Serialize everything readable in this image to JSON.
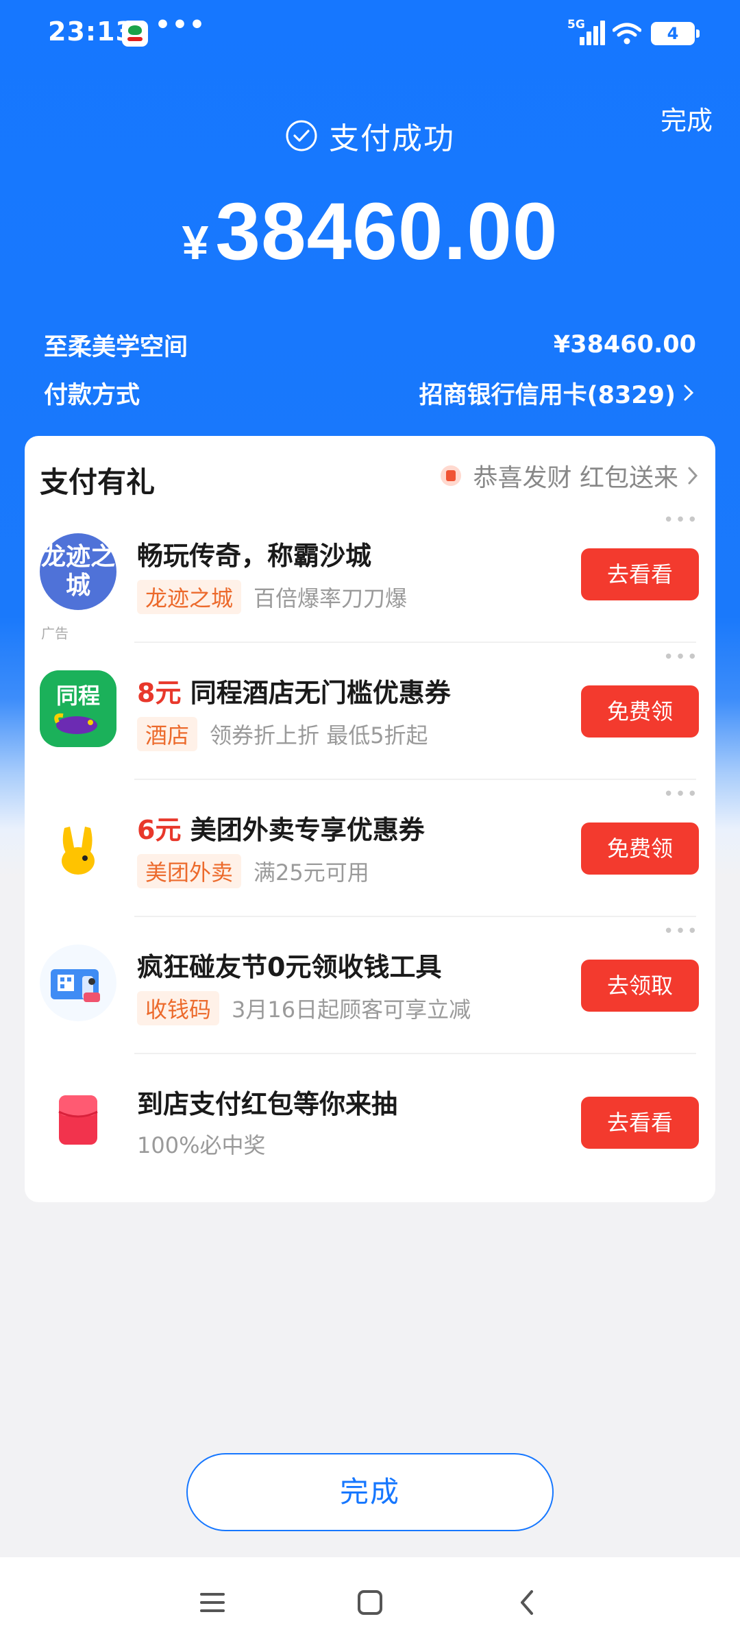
{
  "status_bar": {
    "time": "23:13",
    "more": "•••",
    "network": "5G",
    "battery": "4"
  },
  "header": {
    "done_label": "完成",
    "success_text": "支付成功",
    "currency": "¥",
    "amount": "38460.00",
    "merchant_name": "至柔美学空间",
    "merchant_amount": "¥38460.00",
    "payment_method_label": "付款方式",
    "payment_method_value": "招商银行信用卡(8329)"
  },
  "card": {
    "title": "支付有礼",
    "promo_text": "恭喜发财 红包送来",
    "items": [
      {
        "icon": "longji-game-icon",
        "icon_text": "龙迹之城",
        "price": "",
        "title": "畅玩传奇，称霸沙城",
        "tag": "龙迹之城",
        "sub": "百倍爆率刀刀爆",
        "button": "去看看",
        "ad_label": "广告"
      },
      {
        "icon": "tongcheng-hotel-icon",
        "icon_text": "同程",
        "price": "8元",
        "title": "同程酒店无门槛优惠券",
        "tag": "酒店",
        "sub": "领券折上折 最低5折起",
        "button": "免费领"
      },
      {
        "icon": "meituan-rabbit-icon",
        "price": "6元",
        "title": "美团外卖专享优惠券",
        "tag": "美团外卖",
        "sub": "满25元可用",
        "button": "免费领"
      },
      {
        "icon": "payment-qrcode-icon",
        "price": "",
        "title": "疯狂碰友节0元领收钱工具",
        "tag": "收钱码",
        "sub": "3月16日起顾客可享立减",
        "button": "去领取"
      },
      {
        "icon": "red-packet-icon",
        "price": "",
        "title": "到店支付红包等你来抽",
        "tag": "",
        "sub": "100%必中奖",
        "button": "去看看"
      }
    ]
  },
  "footer": {
    "done_label": "完成"
  },
  "colors": {
    "primary_blue": "#1677ff",
    "button_red": "#f33a2e",
    "tag_orange": "#ec6a2c",
    "price_red": "#e8382b"
  }
}
